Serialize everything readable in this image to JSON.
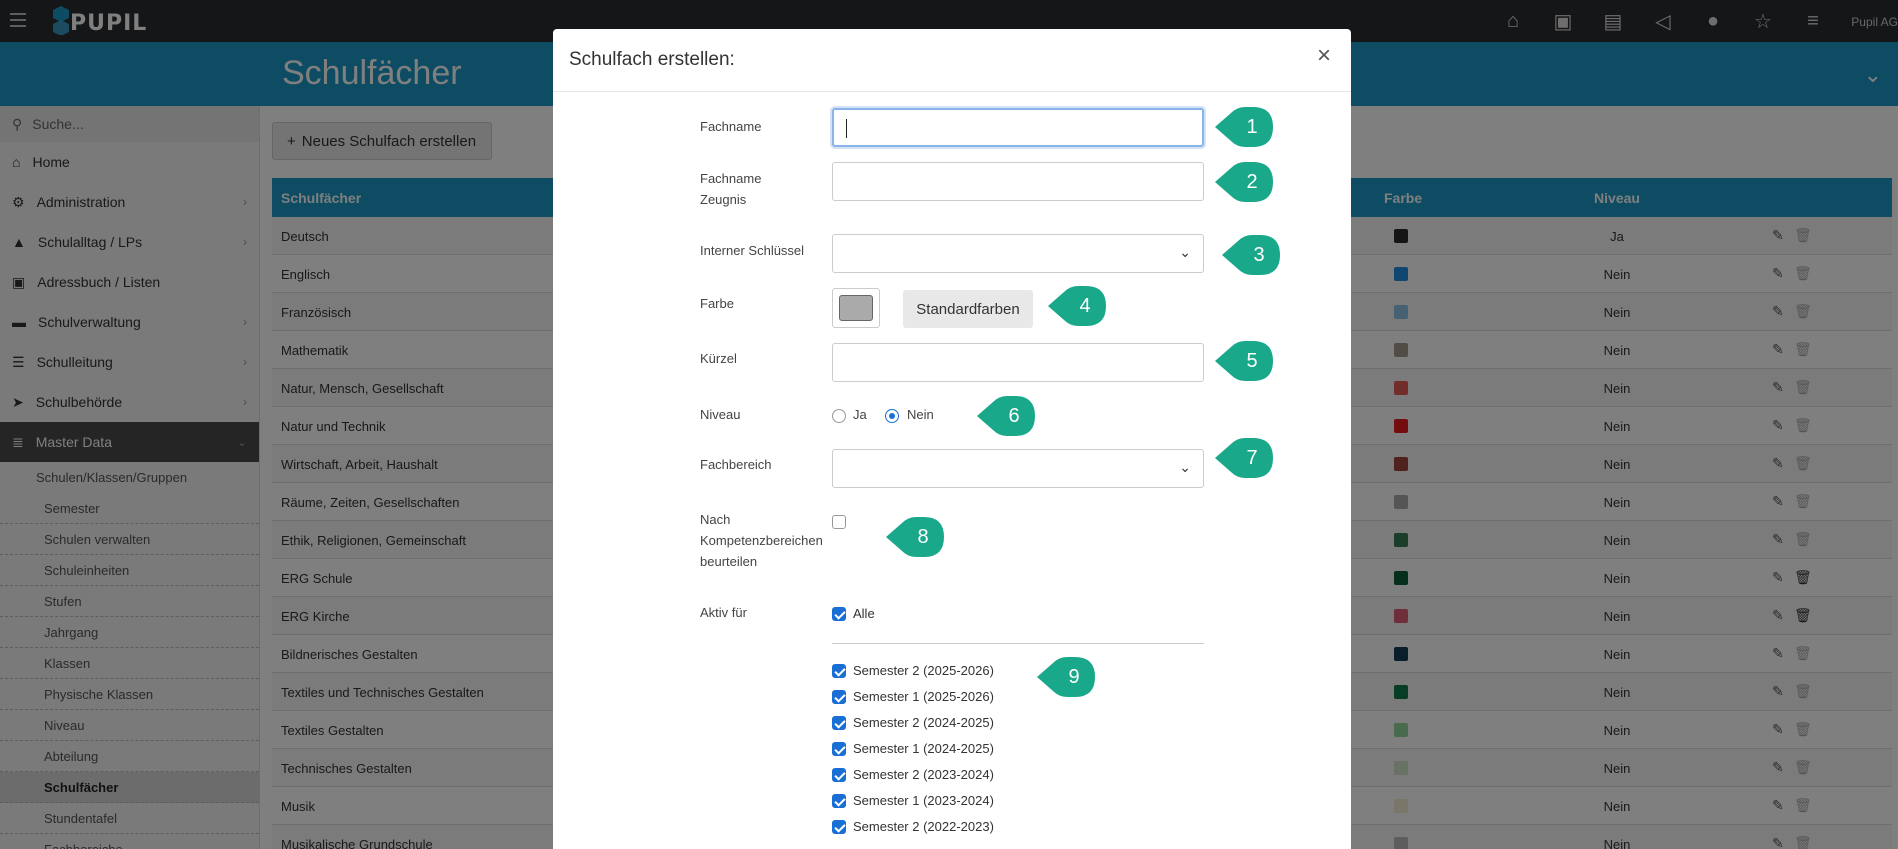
{
  "app": {
    "logo": "PUPIL",
    "user": "Pupil AG"
  },
  "topbar_icons": [
    "home-icon",
    "id-card-icon",
    "book-icon",
    "megaphone-icon",
    "lightbulb-icon",
    "star-icon",
    "sliders-icon"
  ],
  "banner": {
    "title": "Schulfächer"
  },
  "sidebar": {
    "search_placeholder": "Suche...",
    "items": [
      {
        "label": "Home",
        "icon": "home-icon"
      },
      {
        "label": "Administration",
        "icon": "gears-icon"
      },
      {
        "label": "Schulalltag / LPs",
        "icon": "graduation-cap-icon"
      },
      {
        "label": "Adressbuch / Listen",
        "icon": "address-card-icon"
      },
      {
        "label": "Schulverwaltung",
        "icon": "folder-icon"
      },
      {
        "label": "Schulleitung",
        "icon": "signpost-icon"
      },
      {
        "label": "Schulbehörde",
        "icon": "paper-plane-icon"
      },
      {
        "label": "Master Data",
        "icon": "database-icon"
      }
    ],
    "group_label": "Schulen/Klassen/Gruppen",
    "sub_items": [
      "Semester",
      "Schulen verwalten",
      "Schuleinheiten",
      "Stufen",
      "Jahrgang",
      "Klassen",
      "Physische Klassen",
      "Niveau",
      "Abteilung",
      "Schulfächer",
      "Stundentafel",
      "Fachbereiche"
    ]
  },
  "main": {
    "new_button": "Neues Schulfach erstellen",
    "columns": {
      "name": "Schulfächer",
      "color": "Farbe",
      "level": "Niveau"
    },
    "rows": [
      {
        "name": "Deutsch",
        "color": "#2b2b2b",
        "level": "Ja",
        "deletable": false
      },
      {
        "name": "Englisch",
        "color": "#1f8fe0",
        "level": "Nein",
        "deletable": false
      },
      {
        "name": "Französisch",
        "color": "#8ec3e8",
        "level": "Nein",
        "deletable": false
      },
      {
        "name": "Mathematik",
        "color": "#a39a8c",
        "level": "Nein",
        "deletable": false
      },
      {
        "name": "Natur, Mensch, Gesellschaft",
        "color": "#e05a52",
        "level": "Nein",
        "deletable": false
      },
      {
        "name": "Natur und Technik",
        "color": "#e81c1c",
        "level": "Nein",
        "deletable": false
      },
      {
        "name": "Wirtschaft, Arbeit, Haushalt",
        "color": "#a0443c",
        "level": "Nein",
        "deletable": false
      },
      {
        "name": "Räume, Zeiten, Gesellschaften",
        "color": "#aaaaaa",
        "level": "Nein",
        "deletable": false
      },
      {
        "name": "Ethik, Religionen, Gemeinschaft",
        "color": "#3b7a57",
        "level": "Nein",
        "deletable": false
      },
      {
        "name": "ERG Schule",
        "color": "#0a5c36",
        "level": "Nein",
        "deletable": true
      },
      {
        "name": "ERG Kirche",
        "color": "#e05a74",
        "level": "Nein",
        "deletable": true
      },
      {
        "name": "Bildnerisches Gestalten",
        "color": "#153a55",
        "level": "Nein",
        "deletable": false
      },
      {
        "name": "Textiles und Technisches Gestalten",
        "color": "#0f7a4a",
        "level": "Nein",
        "deletable": false
      },
      {
        "name": "Textiles Gestalten",
        "color": "#8fd699",
        "level": "Nein",
        "deletable": false
      },
      {
        "name": "Technisches Gestalten",
        "color": "#cfe3c9",
        "level": "Nein",
        "deletable": false
      },
      {
        "name": "Musik",
        "color": "#f4ecd2",
        "level": "Nein",
        "deletable": false
      },
      {
        "name": "Musikalische Grundschule",
        "color": "#bbbbbb",
        "level": "Nein",
        "deletable": false
      }
    ]
  },
  "modal": {
    "title": "Schulfach erstellen:",
    "fields": {
      "fachname": {
        "label": "Fachname",
        "value": ""
      },
      "fachname_zeugnis": {
        "label": "Fachname Zeugnis",
        "value": ""
      },
      "interner_schluessel": {
        "label": "Interner Schlüssel",
        "value": ""
      },
      "farbe": {
        "label": "Farbe",
        "value": "#aaaaaa",
        "button": "Standardfarben"
      },
      "kuerzel": {
        "label": "Kürzel",
        "value": ""
      },
      "niveau": {
        "label": "Niveau",
        "options": [
          "Ja",
          "Nein"
        ],
        "selected": "Nein"
      },
      "fachbereich": {
        "label": "Fachbereich",
        "value": ""
      },
      "kompetenz": {
        "label": "Nach Kompetenzbereichen beurteilen",
        "checked": false
      },
      "aktiv_fuer": {
        "label": "Aktiv für",
        "all_label": "Alle",
        "all_checked": true,
        "semesters": [
          "Semester 2 (2025-2026)",
          "Semester 1 (2025-2026)",
          "Semester 2 (2024-2025)",
          "Semester 1 (2024-2025)",
          "Semester 2 (2023-2024)",
          "Semester 1 (2023-2024)",
          "Semester 2 (2022-2023)"
        ]
      }
    },
    "markers": [
      "1",
      "2",
      "3",
      "4",
      "5",
      "6",
      "7",
      "8",
      "9"
    ],
    "marker_color": "#1aa88a"
  }
}
